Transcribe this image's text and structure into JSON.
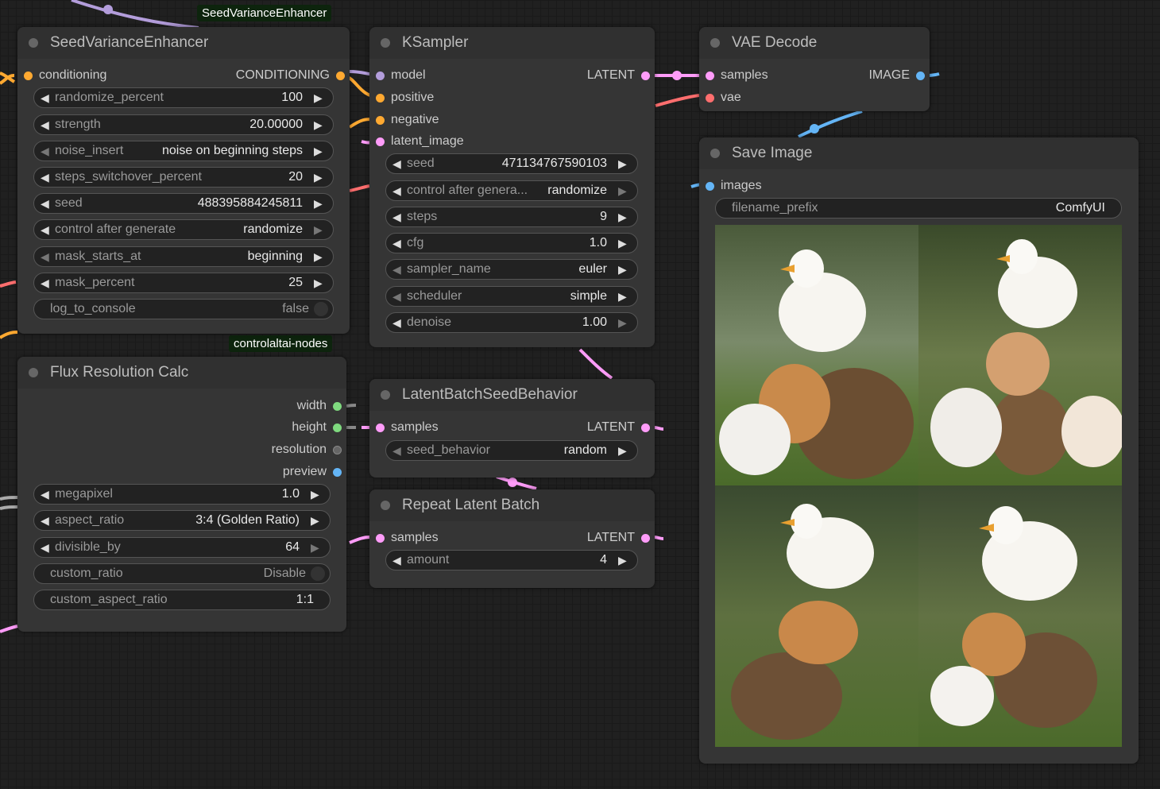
{
  "badges": {
    "top": "SeedVarianceEnhancer",
    "bottom": "controlaltai-nodes"
  },
  "colors": {
    "conditioning": "#ffa931",
    "latent": "#ff9cf9",
    "model": "#b39ddb",
    "vae": "#ff6e6e",
    "image": "#64b5f6",
    "int": "#7fda7f",
    "string": "#666666"
  },
  "seed_variance": {
    "title": "SeedVarianceEnhancer",
    "input_label": "conditioning",
    "output_label": "CONDITIONING",
    "widgets": [
      {
        "label": "randomize_percent",
        "value": "100"
      },
      {
        "label": "strength",
        "value": "20.00000"
      },
      {
        "label": "noise_insert",
        "value": "noise on beginning steps"
      },
      {
        "label": "steps_switchover_percent",
        "value": "20"
      },
      {
        "label": "seed",
        "value": "488395884245811"
      },
      {
        "label": "control after generate",
        "value": "randomize"
      },
      {
        "label": "mask_starts_at",
        "value": "beginning"
      },
      {
        "label": "mask_percent",
        "value": "25"
      },
      {
        "label": "log_to_console",
        "value": "false"
      }
    ]
  },
  "ksampler": {
    "title": "KSampler",
    "inputs": [
      "model",
      "positive",
      "negative",
      "latent_image"
    ],
    "output_label": "LATENT",
    "widgets": [
      {
        "label": "seed",
        "value": "471134767590103"
      },
      {
        "label": "control after genera...",
        "value": "randomize"
      },
      {
        "label": "steps",
        "value": "9"
      },
      {
        "label": "cfg",
        "value": "1.0"
      },
      {
        "label": "sampler_name",
        "value": "euler"
      },
      {
        "label": "scheduler",
        "value": "simple"
      },
      {
        "label": "denoise",
        "value": "1.00"
      }
    ]
  },
  "vae_decode": {
    "title": "VAE Decode",
    "inputs": [
      "samples",
      "vae"
    ],
    "output_label": "IMAGE"
  },
  "save_image": {
    "title": "Save Image",
    "input_label": "images",
    "widget": {
      "label": "filename_prefix",
      "value": "ComfyUI"
    }
  },
  "flux_res": {
    "title": "Flux Resolution Calc",
    "outputs": [
      "width",
      "height",
      "resolution",
      "preview"
    ],
    "widgets": [
      {
        "label": "megapixel",
        "value": "1.0"
      },
      {
        "label": "aspect_ratio",
        "value": "3:4 (Golden Ratio)"
      },
      {
        "label": "divisible_by",
        "value": "64"
      },
      {
        "label": "custom_ratio",
        "value": "Disable"
      },
      {
        "label": "custom_aspect_ratio",
        "value": "1:1"
      }
    ]
  },
  "latent_batch_seed": {
    "title": "LatentBatchSeedBehavior",
    "input_label": "samples",
    "output_label": "LATENT",
    "widget": {
      "label": "seed_behavior",
      "value": "random"
    }
  },
  "repeat_latent": {
    "title": "Repeat Latent Batch",
    "input_label": "samples",
    "output_label": "LATENT",
    "widget": {
      "label": "amount",
      "value": "4"
    }
  }
}
